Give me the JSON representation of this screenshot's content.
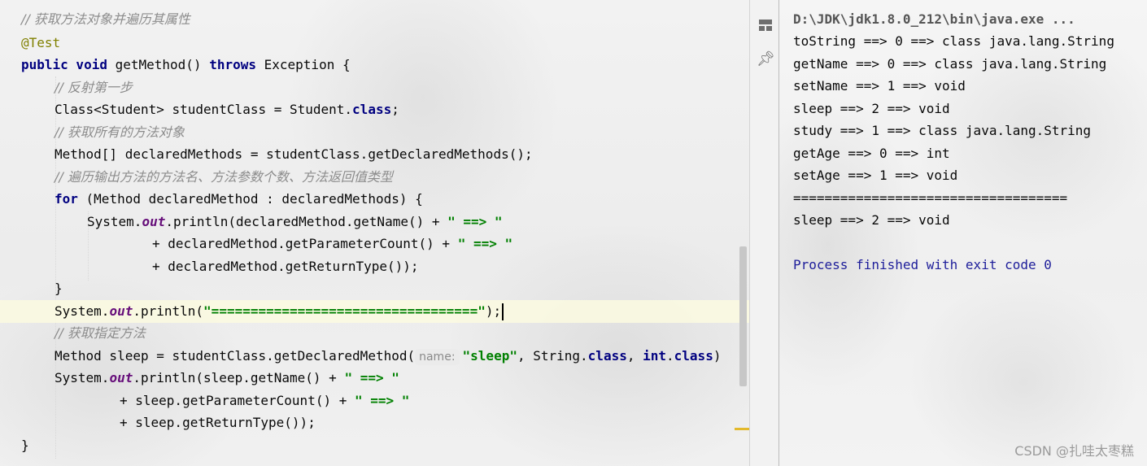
{
  "editor": {
    "lines": [
      [
        {
          "t": "// 获取方法对象并遍历其属性",
          "c": "cm"
        }
      ],
      [
        {
          "t": "@Test",
          "c": "an"
        }
      ],
      [
        {
          "t": "public void",
          "c": "kw"
        },
        {
          "t": " getMethod() "
        },
        {
          "t": "throws",
          "c": "kw"
        },
        {
          "t": " Exception {"
        }
      ],
      [
        {
          "t": "// 反射第一步",
          "c": "cm"
        }
      ],
      [
        {
          "t": "Class<Student> studentClass = Student."
        },
        {
          "t": "class",
          "c": "kw"
        },
        {
          "t": ";"
        }
      ],
      [
        {
          "t": "// 获取所有的方法对象",
          "c": "cm"
        }
      ],
      [
        {
          "t": "Method[] declaredMethods = studentClass.getDeclaredMethods();"
        }
      ],
      [
        {
          "t": "// 遍历输出方法的方法名、方法参数个数、方法返回值类型",
          "c": "cm"
        }
      ],
      [
        {
          "t": "for",
          "c": "kw"
        },
        {
          "t": " (Method declaredMethod : declaredMethods) {"
        }
      ],
      [
        {
          "t": "System."
        },
        {
          "t": "out",
          "c": "fld"
        },
        {
          "t": ".println(declaredMethod.getName() + "
        },
        {
          "t": "\" ==> \"",
          "c": "st"
        }
      ],
      [
        {
          "t": "+ declaredMethod.getParameterCount() + "
        },
        {
          "t": "\" ==> \"",
          "c": "st"
        }
      ],
      [
        {
          "t": "+ declaredMethod.getReturnType());"
        }
      ],
      [
        {
          "t": "}"
        }
      ],
      [
        {
          "t": "System."
        },
        {
          "t": "out",
          "c": "fld"
        },
        {
          "t": ".println("
        },
        {
          "t": "\"==================================\"",
          "c": "st"
        },
        {
          "t": ");"
        }
      ],
      [
        {
          "t": "// 获取指定方法",
          "c": "cm"
        }
      ],
      [
        {
          "t": "Method sleep = studentClass.getDeclaredMethod("
        },
        {
          "t": "name:",
          "c": "hint"
        },
        {
          "t": "\"sleep\"",
          "c": "st"
        },
        {
          "t": ", String."
        },
        {
          "t": "class",
          "c": "kw"
        },
        {
          "t": ", "
        },
        {
          "t": "int",
          "c": "kw"
        },
        {
          "t": "."
        },
        {
          "t": "class",
          "c": "kw"
        },
        {
          "t": ")"
        }
      ],
      [
        {
          "t": "System."
        },
        {
          "t": "out",
          "c": "fld"
        },
        {
          "t": ".println(sleep.getName() + "
        },
        {
          "t": "\" ==> \"",
          "c": "st"
        }
      ],
      [
        {
          "t": "+ sleep.getParameterCount() + "
        },
        {
          "t": "\" ==> \"",
          "c": "st"
        }
      ],
      [
        {
          "t": "+ sleep.getReturnType());"
        }
      ],
      [
        {
          "t": ""
        }
      ],
      [
        {
          "t": "}"
        }
      ]
    ]
  },
  "console": {
    "command": "D:\\JDK\\jdk1.8.0_212\\bin\\java.exe ...",
    "output": [
      "toString ==> 0 ==> class java.lang.String",
      "getName ==> 0 ==> class java.lang.String",
      "setName ==> 1 ==> void",
      "sleep ==> 2 ==> void",
      "study ==> 1 ==> class java.lang.String",
      "getAge ==> 0 ==> int",
      "setAge ==> 1 ==> void",
      "===================================",
      "sleep ==> 2 ==> void",
      "",
      "Process finished with exit code 0"
    ]
  },
  "tool_strip": {
    "icons": [
      "layout-icon",
      "pin-icon"
    ]
  },
  "watermark": "CSDN @扎哇太枣糕"
}
